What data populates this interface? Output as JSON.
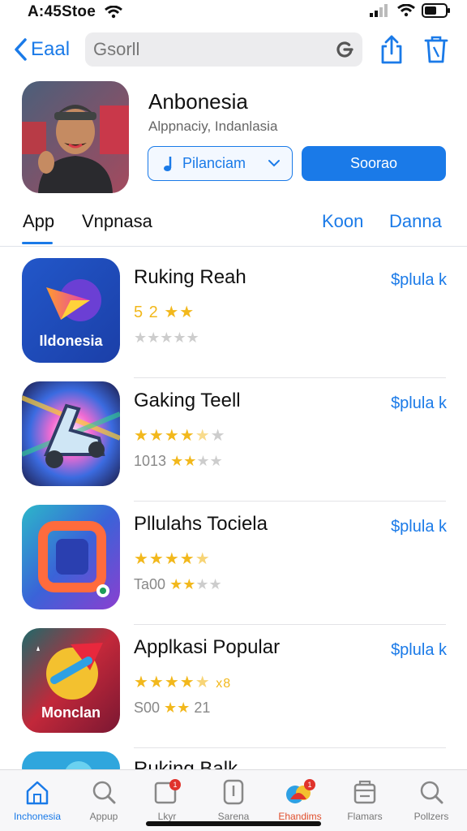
{
  "status_bar": {
    "time": "A:45Stoe"
  },
  "nav": {
    "back_label": "Eaal",
    "search_value": "Gsorll"
  },
  "header": {
    "title": "Anbonesia",
    "subtitle": "Alppnaciy, Indanlasia",
    "dropdown_label": "Pilanciam",
    "primary_label": "Soorao"
  },
  "tabs": [
    "App",
    "Vnpnasa",
    "Koon",
    "Danna"
  ],
  "apps": [
    {
      "name": "Ruking Reah",
      "price": "$plula k",
      "stars_line1": "5 2 ★★",
      "rating1": "",
      "stars_line2": "",
      "icon_text": "Ildonesia"
    },
    {
      "name": "Gaking Teell",
      "price": "$plula k",
      "rating_prefix": "1013",
      "icon_text": ""
    },
    {
      "name": "Pllulahs Tociela",
      "price": "$plula k",
      "rating_prefix": "Ta00",
      "icon_text": ""
    },
    {
      "name": "Applkasi Popular",
      "price": "$plula k",
      "rating_prefix": "S00",
      "rating_suffix": "21",
      "rating1_suffix": "x8",
      "icon_text": "Monclan"
    }
  ],
  "partial_row": {
    "name": "Ruking Balk"
  },
  "bottom_tabs": [
    {
      "label": "Inchonesia",
      "icon": "home-icon"
    },
    {
      "label": "Appup",
      "icon": "search-icon"
    },
    {
      "label": "Lkyr",
      "icon": "screen-icon"
    },
    {
      "label": "Sarena",
      "icon": "phone-icon"
    },
    {
      "label": "Ehandims",
      "icon": "games-icon"
    },
    {
      "label": "Flamars",
      "icon": "store-icon"
    },
    {
      "label": "Pollzers",
      "icon": "search-icon"
    }
  ],
  "colors": {
    "accent": "#1a7ae8",
    "star": "#f2b81c",
    "badge": "#e0332c"
  }
}
